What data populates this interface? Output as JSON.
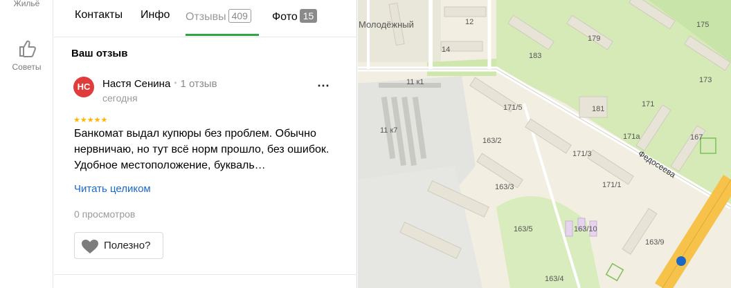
{
  "rail": {
    "top_label": "Жильё",
    "tips_label": "Советы"
  },
  "tabs": {
    "contacts": "Контакты",
    "info": "Инфо",
    "reviews": "Отзывы",
    "reviews_count": "409",
    "photo": "Фото",
    "photo_count": "15"
  },
  "review_section": {
    "heading": "Ваш отзыв"
  },
  "review": {
    "avatar_initials": "НС",
    "author": "Настя Сенина",
    "author_reviews": "1 отзыв",
    "date": "сегодня",
    "rating": 5,
    "stars": "★★★★★",
    "text": "Банкомат выдал купюры без проблем. Обычно нервничаю, но тут всё норм прошло, без ошибок. Удобное местоположение, букваль…",
    "read_more": "Читать целиком",
    "views": "0 просмотров",
    "useful": "Полезно?"
  },
  "map": {
    "district": "Молодёжный",
    "street": "Федосеева",
    "labels": [
      "12",
      "14",
      "11 к1",
      "11 к7",
      "183",
      "179",
      "175",
      "181",
      "171/5",
      "171",
      "173",
      "163/2",
      "171/3",
      "171а",
      "167",
      "163/3",
      "171/1",
      "163/5",
      "163/10",
      "163/9",
      "163/4"
    ]
  },
  "colors": {
    "accent_green": "#2ba640",
    "link_blue": "#1a69c9",
    "avatar_red": "#e03c3c",
    "star_yellow": "#ffb400"
  }
}
